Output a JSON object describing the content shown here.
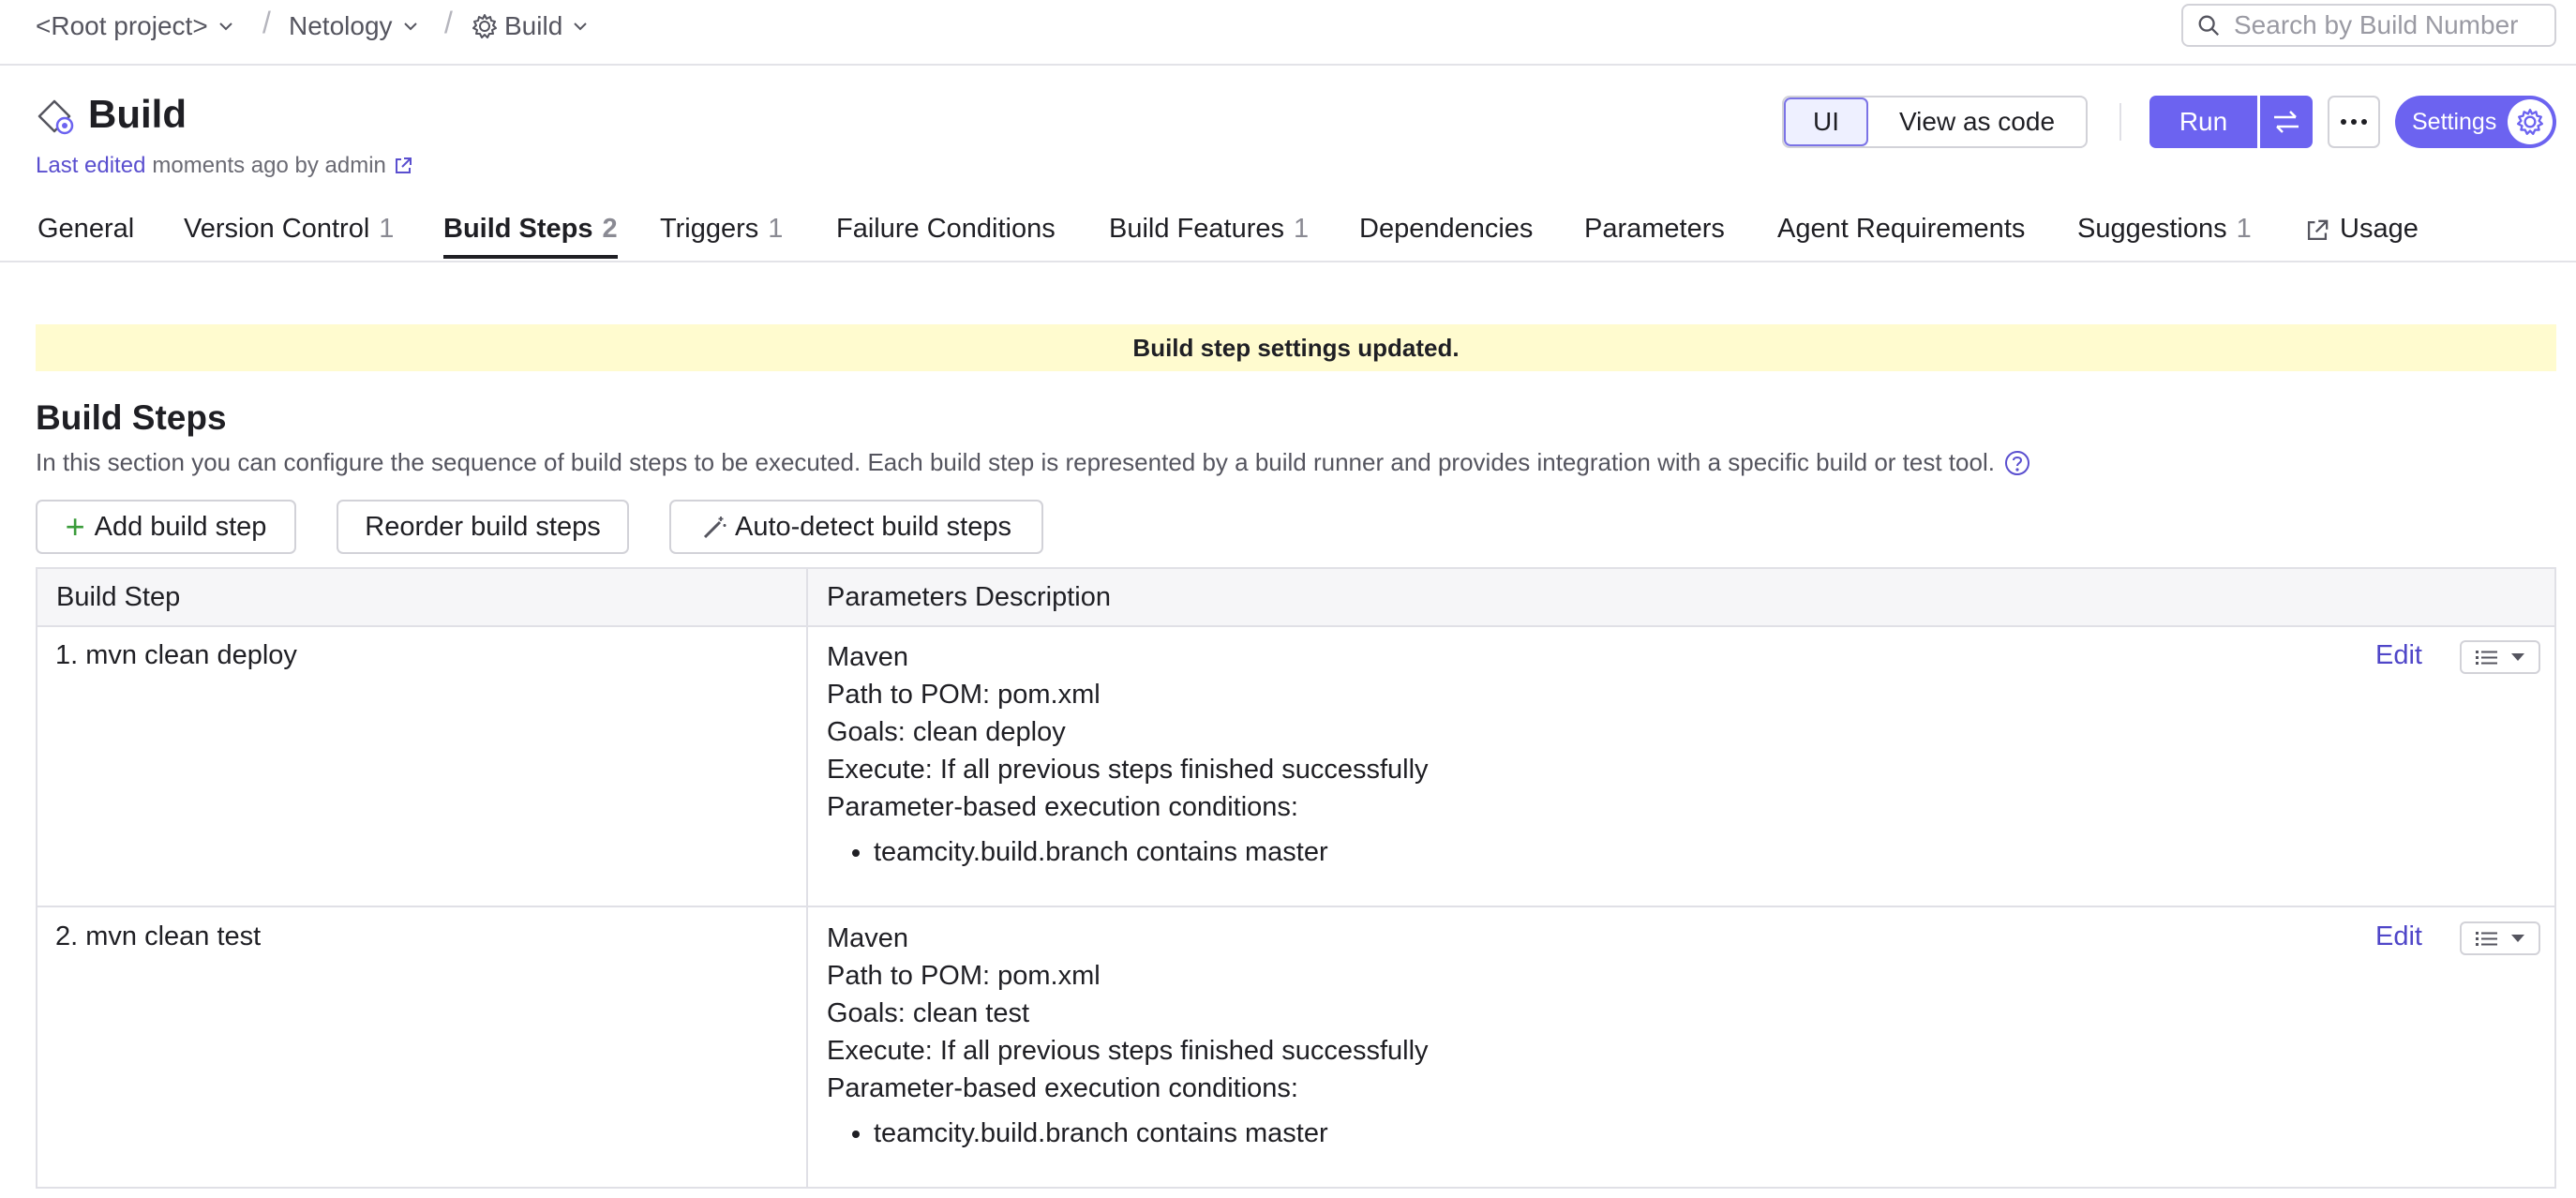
{
  "breadcrumb": {
    "root": "<Root project>",
    "project": "Netology",
    "config": "Build"
  },
  "search": {
    "placeholder": "Search by Build Number"
  },
  "header": {
    "title": "Build",
    "last_edited_link": "Last edited",
    "last_edited_rest": "moments ago by admin"
  },
  "view_toggle": {
    "ui": "UI",
    "code": "View as code"
  },
  "actions": {
    "run": "Run",
    "settings": "Settings"
  },
  "tabs": [
    {
      "label": "General",
      "count": ""
    },
    {
      "label": "Version Control",
      "count": "1"
    },
    {
      "label": "Build Steps",
      "count": "2"
    },
    {
      "label": "Triggers",
      "count": "1"
    },
    {
      "label": "Failure Conditions",
      "count": ""
    },
    {
      "label": "Build Features",
      "count": "1"
    },
    {
      "label": "Dependencies",
      "count": ""
    },
    {
      "label": "Parameters",
      "count": ""
    },
    {
      "label": "Agent Requirements",
      "count": ""
    },
    {
      "label": "Suggestions",
      "count": "1"
    },
    {
      "label": "Usage",
      "count": ""
    }
  ],
  "banner": "Build step settings updated.",
  "section": {
    "title": "Build Steps",
    "description": "In this section you can configure the sequence of build steps to be executed. Each build step is represented by a build runner and provides integration with a specific build or test tool."
  },
  "buttons": {
    "add": "Add build step",
    "reorder": "Reorder build steps",
    "autodetect": "Auto-detect build steps"
  },
  "table": {
    "headers": [
      "Build Step",
      "Parameters Description"
    ],
    "rows": [
      {
        "name": "1. mvn clean deploy",
        "runner": "Maven",
        "pom": "Path to POM: pom.xml",
        "goals": "Goals: clean deploy",
        "execute": "Execute: If all previous steps finished successfully",
        "conditions_label": "Parameter-based execution conditions:",
        "condition": "teamcity.build.branch contains master",
        "edit": "Edit"
      },
      {
        "name": "2. mvn clean test",
        "runner": "Maven",
        "pom": "Path to POM: pom.xml",
        "goals": "Goals: clean test",
        "execute": "Execute: If all previous steps finished successfully",
        "conditions_label": "Parameter-based execution conditions:",
        "condition": "teamcity.build.branch contains master",
        "edit": "Edit"
      }
    ]
  },
  "colors": {
    "accent": "#6c63f0",
    "link": "#5a4fcf",
    "banner_bg": "#fffbcf",
    "add_icon": "#3b9c3b"
  }
}
